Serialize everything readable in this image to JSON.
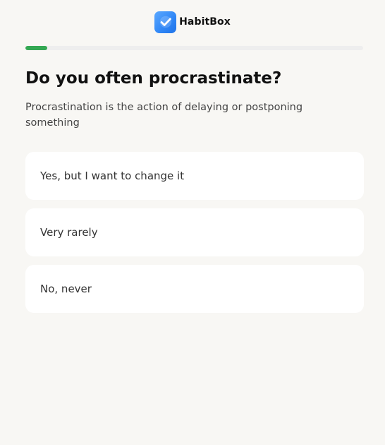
{
  "app": {
    "brand_name": "HabitBox",
    "logo_icon": "checkmark-icon",
    "accent_color": "#34a853",
    "logo_color": "#2f86f6"
  },
  "progress": {
    "fraction": 0.065
  },
  "question": {
    "title": "Do you often procrastinate?",
    "subtitle": "Procrastination is the action of delaying or postponing something"
  },
  "options": [
    {
      "label": "Yes, but I want to change it"
    },
    {
      "label": "Very rarely"
    },
    {
      "label": "No, never"
    }
  ]
}
